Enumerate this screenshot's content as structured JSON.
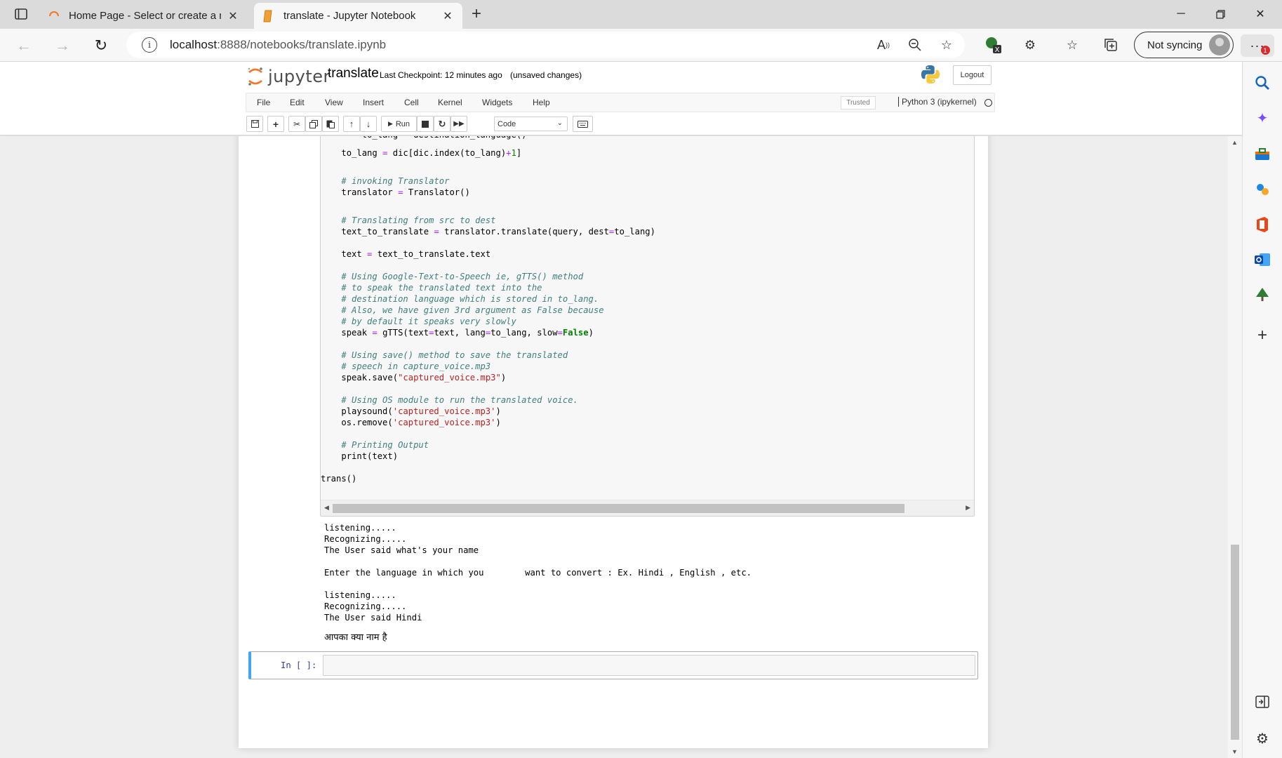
{
  "browser": {
    "tabs": [
      {
        "title": "Home Page - Select or create a notebook",
        "active": false
      },
      {
        "title": "translate - Jupyter Notebook",
        "active": true
      }
    ],
    "new_tab_label": "+",
    "url": {
      "host": "localhost",
      "path": ":8888/notebooks/translate.ipynb"
    },
    "sync_label": "Not syncing",
    "notification_count": "1"
  },
  "jupyter": {
    "logo_text": "jupyter",
    "notebook_name": "translate",
    "checkpoint": "Last Checkpoint: 12 minutes ago",
    "unsaved": "(unsaved changes)",
    "logout_label": "Logout",
    "menu": [
      "File",
      "Edit",
      "View",
      "Insert",
      "Cell",
      "Kernel",
      "Widgets",
      "Help"
    ],
    "trusted_label": "Trusted",
    "kernel_name": "Python 3 (ipykernel)",
    "toolbar": {
      "run_label": "Run",
      "cell_type": "Code"
    }
  },
  "code_lines": [
    {
      "indent": 8,
      "text": "to_lang = destination_language()"
    },
    {
      "indent": 4,
      "text": "to_lang = dic[dic.index(to_lang)+1]"
    },
    {
      "indent": 4,
      "text": "# invoking Translator"
    },
    {
      "indent": 4,
      "text": "translator = Translator()"
    },
    {
      "indent": 4,
      "text": "# Translating from src to dest"
    },
    {
      "indent": 4,
      "text": "text_to_translate = translator.translate(query, dest=to_lang)"
    },
    {
      "indent": 4,
      "text": "text = text_to_translate.text"
    },
    {
      "indent": 4,
      "text": "# Using Google-Text-to-Speech ie, gTTS() method"
    },
    {
      "indent": 4,
      "text": "# to speak the translated text into the"
    },
    {
      "indent": 4,
      "text": "# destination language which is stored in to_lang."
    },
    {
      "indent": 4,
      "text": "# Also, we have given 3rd argument as False because"
    },
    {
      "indent": 4,
      "text": "# by default it speaks very slowly"
    },
    {
      "indent": 4,
      "text": "speak = gTTS(text=text, lang=to_lang, slow=False)"
    },
    {
      "indent": 4,
      "text": "# Using save() method to save the translated"
    },
    {
      "indent": 4,
      "text": "# speech in capture_voice.mp3"
    },
    {
      "indent": 4,
      "text": "speak.save(\"captured_voice.mp3\")"
    },
    {
      "indent": 4,
      "text": "# Using OS module to run the translated voice."
    },
    {
      "indent": 4,
      "text": "playsound('captured_voice.mp3')"
    },
    {
      "indent": 4,
      "text": "os.remove('captured_voice.mp3')"
    },
    {
      "indent": 4,
      "text": "# Printing Output"
    },
    {
      "indent": 4,
      "text": "print(text)"
    },
    {
      "indent": 0,
      "text": "trans()"
    }
  ],
  "output_lines": [
    "listening.....",
    "Recognizing.....",
    "The User said what's your name",
    "Enter the language in which you        want to convert : Ex. Hindi , English , etc.",
    "listening.....",
    "Recognizing.....",
    "The User said Hindi",
    "आपका क्या नाम है"
  ],
  "empty_cell_prompt": "In [ ]:",
  "colors": {
    "accent": "#f37726",
    "cell_selected": "#42a5f5",
    "prompt": "#303f9f",
    "comment": "#408080",
    "string": "#ba2121"
  }
}
